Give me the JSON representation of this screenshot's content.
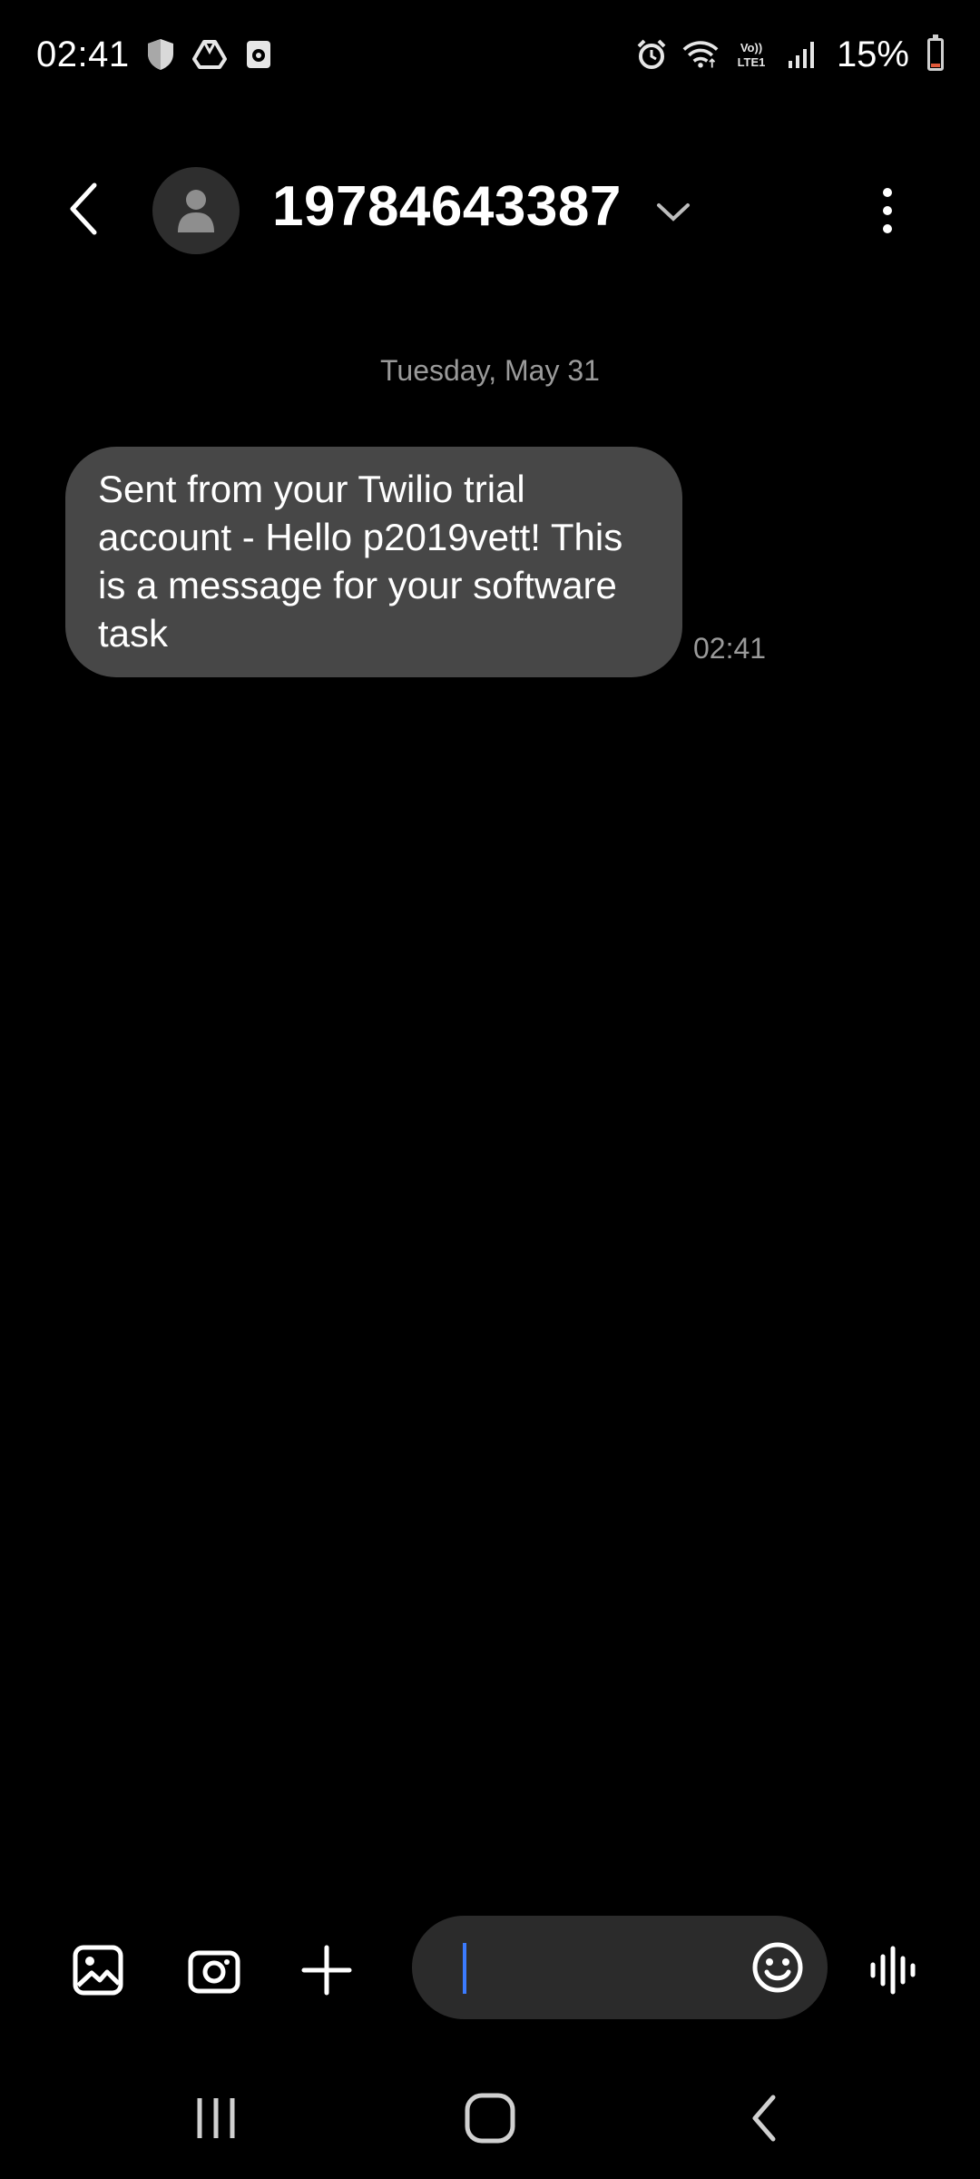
{
  "status_bar": {
    "time": "02:41",
    "battery_percent": "15%",
    "battery_level": 0.15,
    "left_icons": [
      "shield-icon",
      "drive-icon",
      "camera-app-icon"
    ],
    "right_icons": [
      "alarm-icon",
      "wifi-icon",
      "volte-icon",
      "signal-icon",
      "battery-icon"
    ],
    "volte_text": "Vo)) LTE1"
  },
  "header": {
    "contact": "19784643387"
  },
  "conversation": {
    "date": "Tuesday, May 31",
    "messages": [
      {
        "text": "Sent from your Twilio trial account - Hello p2019vett! This is a message for your software task",
        "time": "02:41"
      }
    ]
  },
  "composer": {
    "placeholder": "",
    "buttons": [
      "gallery-icon",
      "camera-icon",
      "plus-icon",
      "emoji-icon",
      "voice-icon"
    ]
  },
  "colors": {
    "background": "#000000",
    "bubble": "#474747",
    "compose": "#2b2b2b",
    "caret": "#3b7bff",
    "muted_text": "#9a9a9a",
    "battery_low": "#e25a3b"
  }
}
